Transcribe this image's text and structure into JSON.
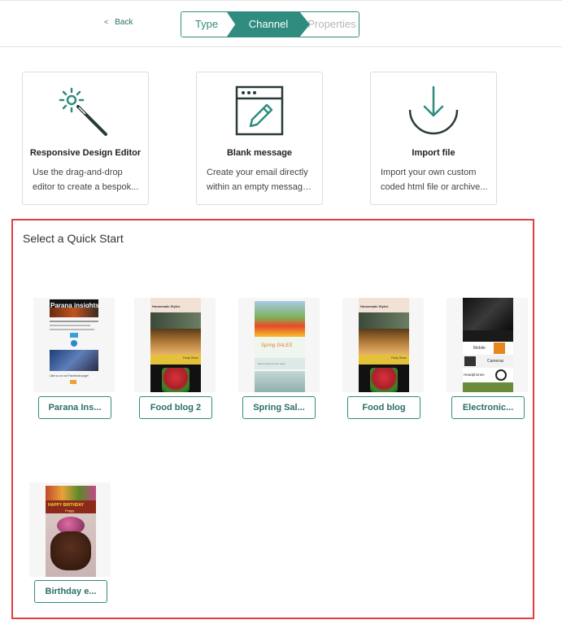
{
  "header": {
    "back_label": "Back",
    "back_chevron": "<",
    "steps": [
      {
        "label": "Type",
        "state": "done"
      },
      {
        "label": "Channel",
        "state": "active"
      },
      {
        "label": "Properties",
        "state": "upcoming"
      }
    ]
  },
  "options": [
    {
      "title": "Responsive Design Editor",
      "desc_line1": "Use the drag-and-drop",
      "desc_line2": "editor to create a bespok...",
      "icon": "magic-wand-icon"
    },
    {
      "title": "Blank message",
      "desc_line1": "Create your email directly",
      "desc_line2": "within an empty message...",
      "icon": "browser-edit-icon"
    },
    {
      "title": "Import file",
      "desc_line1": "Import your own custom",
      "desc_line2": "coded html file or archive...",
      "icon": "download-icon"
    }
  ],
  "quick_start": {
    "title": "Select a Quick Start",
    "templates": [
      {
        "label": "Parana Ins...",
        "thumb_title": "Parana insights",
        "thumb_text": "Like us on our Facebook page!"
      },
      {
        "label": "Food blog 2",
        "thumb_title": "Homemade Styles",
        "thumb_text": "Fruity Show"
      },
      {
        "label": "Spring Sal...",
        "thumb_title": "Spring SALES",
        "thumb_text": "Spring sales for the week"
      },
      {
        "label": "Food blog",
        "thumb_title": "Homemade Styles",
        "thumb_text": "Fruity Show"
      },
      {
        "label": "Electronic...",
        "thumb_title": "Mobile",
        "thumb_text": "Cameras",
        "thumb_text2": "Headphones"
      },
      {
        "label": "Birthday e...",
        "thumb_title": "HAPPY BIRTHDAY",
        "thumb_text": "Peggy"
      }
    ]
  },
  "colors": {
    "accent": "#2f8c7e",
    "highlight_border": "#e0413d"
  }
}
